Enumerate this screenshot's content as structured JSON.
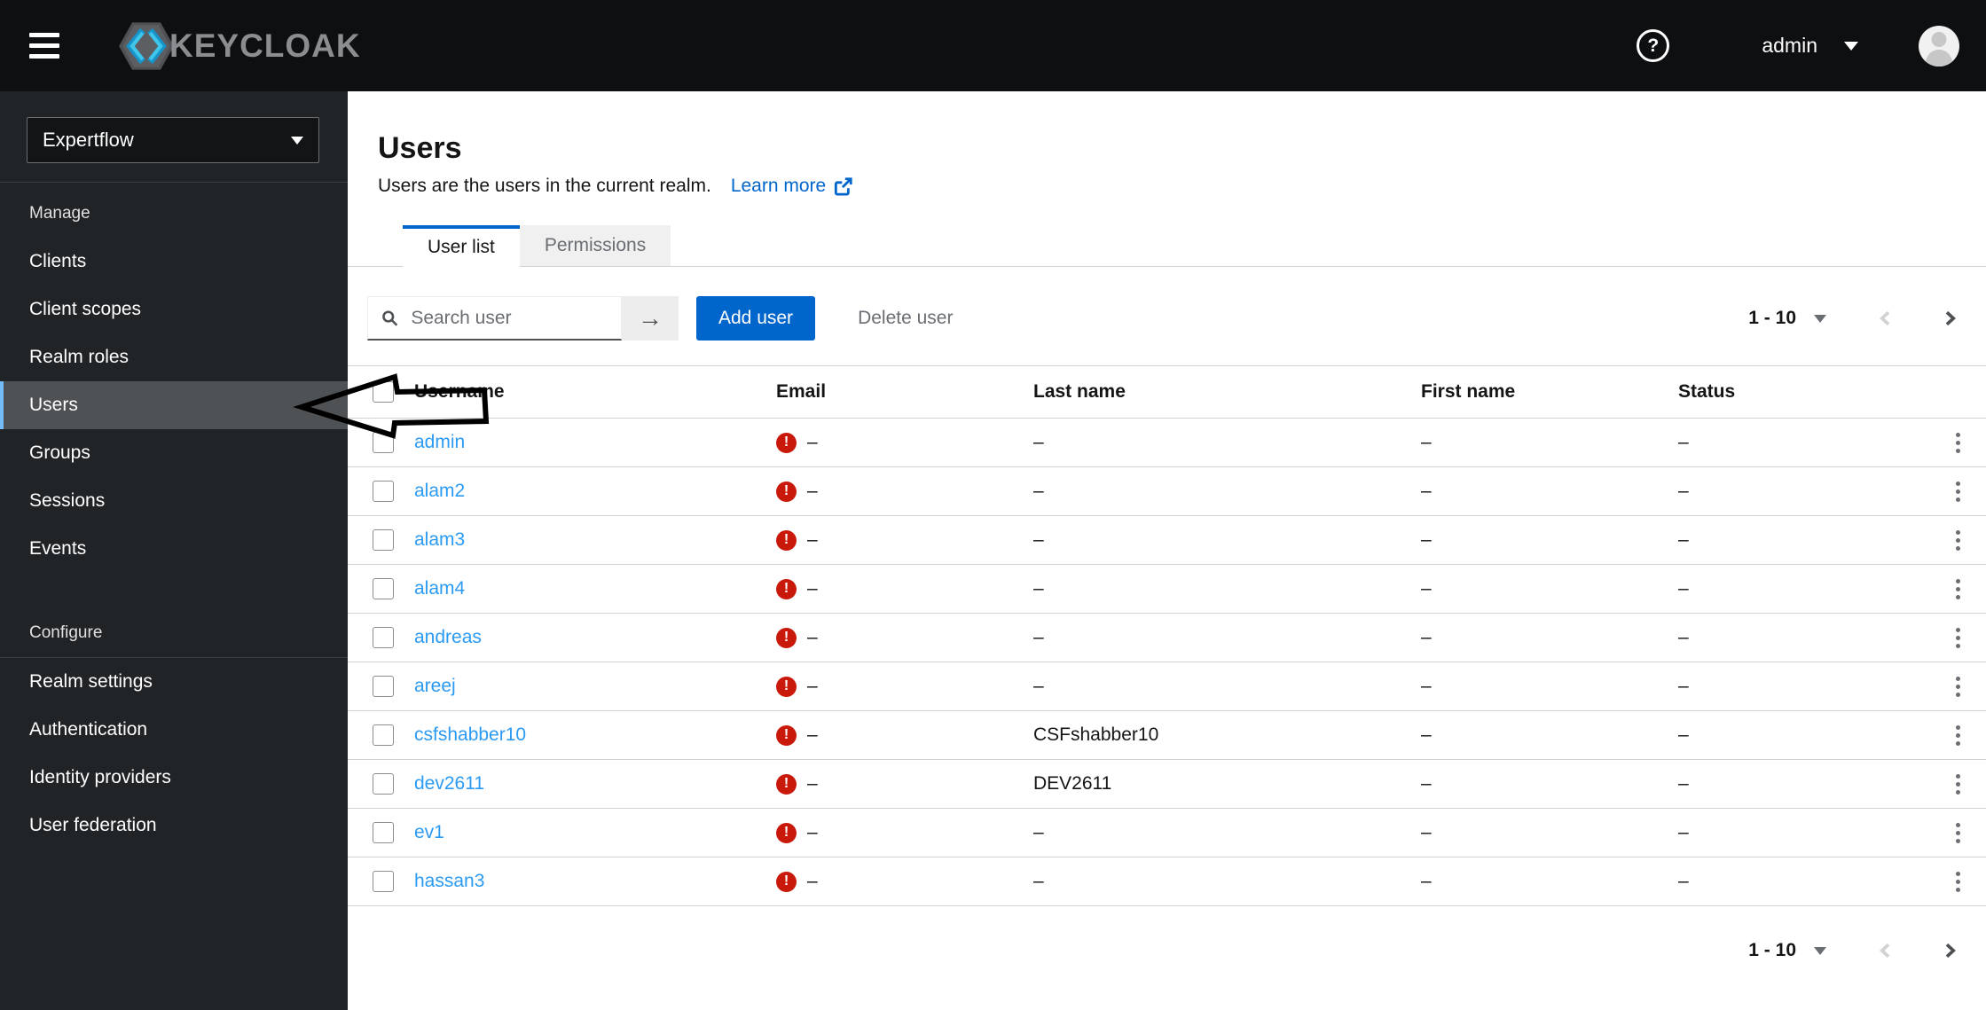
{
  "header": {
    "brand": "KEYCLOAK",
    "help_glyph": "?",
    "user_menu_label": "admin"
  },
  "sidebar": {
    "realm": "Expertflow",
    "groups": [
      {
        "label": "Manage",
        "items": [
          {
            "label": "Clients"
          },
          {
            "label": "Client scopes"
          },
          {
            "label": "Realm roles"
          },
          {
            "label": "Users",
            "active": true
          },
          {
            "label": "Groups"
          },
          {
            "label": "Sessions"
          },
          {
            "label": "Events"
          }
        ]
      },
      {
        "label": "Configure",
        "items": [
          {
            "label": "Realm settings"
          },
          {
            "label": "Authentication"
          },
          {
            "label": "Identity providers"
          },
          {
            "label": "User federation"
          }
        ]
      }
    ]
  },
  "main": {
    "title": "Users",
    "subtitle": "Users are the users in the current realm.",
    "learn_more_label": "Learn more",
    "tabs": [
      {
        "label": "User list",
        "active": true
      },
      {
        "label": "Permissions",
        "active": false
      }
    ],
    "toolbar": {
      "search_placeholder": "Search user",
      "search_submit_glyph": "→",
      "add_user_label": "Add user",
      "delete_user_label": "Delete user"
    },
    "pagination": {
      "range": "1 - 10"
    },
    "table": {
      "columns": [
        "Username",
        "Email",
        "Last name",
        "First name",
        "Status"
      ],
      "email_alert_glyph": "!",
      "rows": [
        {
          "username": "admin",
          "email": "–",
          "last_name": "–",
          "first_name": "–",
          "status": "–"
        },
        {
          "username": "alam2",
          "email": "–",
          "last_name": "–",
          "first_name": "–",
          "status": "–"
        },
        {
          "username": "alam3",
          "email": "–",
          "last_name": "–",
          "first_name": "–",
          "status": "–"
        },
        {
          "username": "alam4",
          "email": "–",
          "last_name": "–",
          "first_name": "–",
          "status": "–"
        },
        {
          "username": "andreas",
          "email": "–",
          "last_name": "–",
          "first_name": "–",
          "status": "–"
        },
        {
          "username": "areej",
          "email": "–",
          "last_name": "–",
          "first_name": "–",
          "status": "–"
        },
        {
          "username": "csfshabber10",
          "email": "–",
          "last_name": "CSFshabber10",
          "first_name": "–",
          "status": "–"
        },
        {
          "username": "dev2611",
          "email": "–",
          "last_name": "DEV2611",
          "first_name": "–",
          "status": "–"
        },
        {
          "username": "ev1",
          "email": "–",
          "last_name": "–",
          "first_name": "–",
          "status": "–"
        },
        {
          "username": "hassan3",
          "email": "–",
          "last_name": "–",
          "first_name": "–",
          "status": "–"
        }
      ]
    }
  },
  "annotation": {
    "shape": "hand-drawn-left-arrow",
    "target": "sidebar-item-users",
    "color": "#000000"
  },
  "colors": {
    "masthead_bg": "#0e0f11",
    "sidebar_bg": "#212427",
    "active_nav_bg": "#4f5255",
    "active_nav_border": "#73bcf7",
    "accent": "#0066cc",
    "username_link": "#2b9af3",
    "alert_red": "#c9190b",
    "muted_text": "#6a6e73",
    "row_border": "#d2d2d2"
  }
}
